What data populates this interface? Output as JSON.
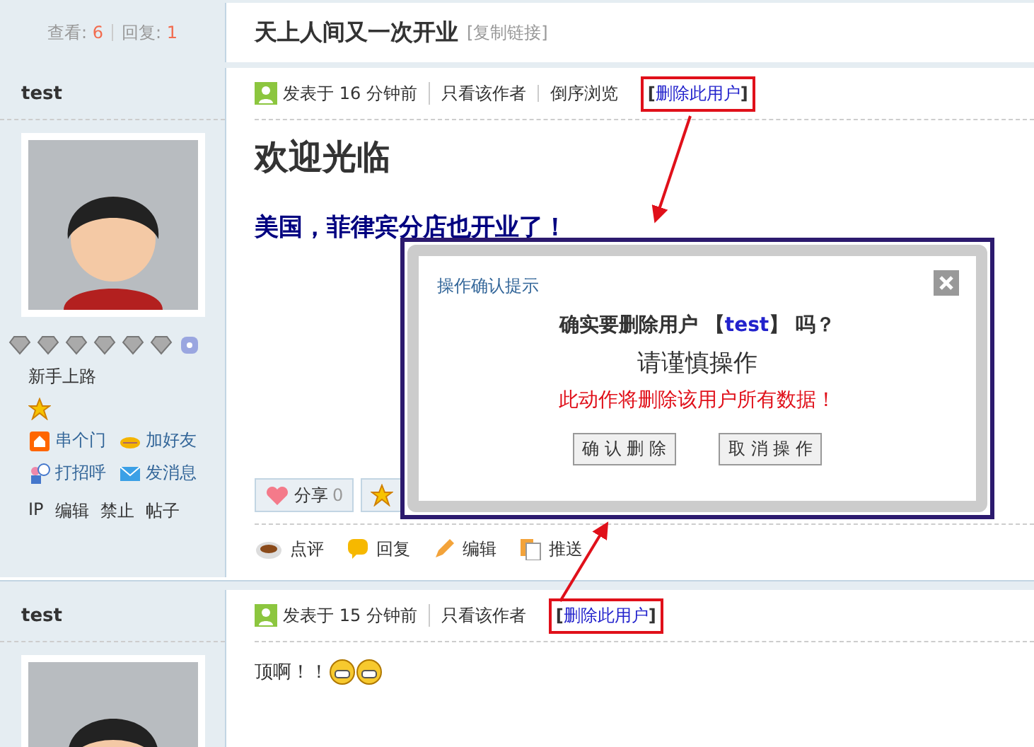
{
  "thread": {
    "views_label": "查看:",
    "views": "6",
    "replies_label": "回复:",
    "replies": "1",
    "title": "天上人间又一次开业",
    "copy_link": "[复制链接]"
  },
  "posts": [
    {
      "author": "test",
      "rank": "新手上路",
      "links": [
        {
          "kind": "home",
          "label": "串个门"
        },
        {
          "kind": "friend",
          "label": "加好友"
        },
        {
          "kind": "greet",
          "label": "打招呼"
        },
        {
          "kind": "mail",
          "label": "发消息"
        }
      ],
      "admin": [
        "IP",
        "编辑",
        "禁止",
        "帖子"
      ],
      "meta": [
        {
          "kind": "time",
          "text": "发表于 16 分钟前"
        },
        {
          "kind": "link",
          "text": "只看该作者"
        },
        {
          "kind": "link",
          "text": "倒序浏览"
        },
        {
          "kind": "delete",
          "open": "[",
          "text": "删除此用户",
          "close": "]"
        }
      ],
      "heading": "欢迎光临",
      "subtitle": "美国，菲律宾分店也开业了！",
      "buttons": [
        {
          "kind": "share",
          "label": "分享",
          "count": "0"
        },
        {
          "kind": "favorite"
        }
      ],
      "actions": [
        {
          "kind": "comment",
          "label": "点评"
        },
        {
          "kind": "reply",
          "label": "回复"
        },
        {
          "kind": "edit",
          "label": "编辑"
        },
        {
          "kind": "push",
          "label": "推送"
        }
      ]
    },
    {
      "author": "test",
      "meta": [
        {
          "kind": "time",
          "text": "发表于 15 分钟前"
        },
        {
          "kind": "link",
          "text": "只看该作者"
        },
        {
          "kind": "delete",
          "open": "[",
          "text": "删除此用户",
          "close": "]"
        }
      ],
      "text": "顶啊！！",
      "emojis": [
        {
          "kind": "grin"
        },
        {
          "kind": "grin"
        }
      ]
    }
  ],
  "dialog": {
    "title": "操作确认提示",
    "question_before": "确实要删除用户 【",
    "question_user": "test",
    "question_after": "】 吗？",
    "caution": "请谨慎操作",
    "warning": "此动作将删除该用户所有数据！",
    "buttons": [
      "确 认 删 除",
      "取 消 操 作"
    ]
  }
}
